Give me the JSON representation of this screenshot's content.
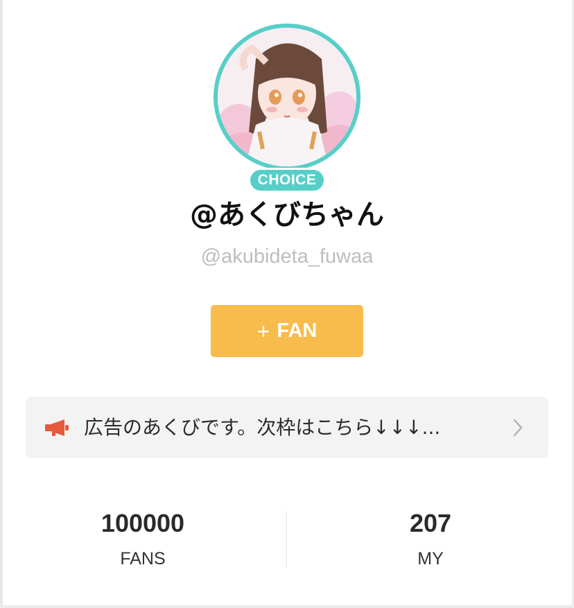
{
  "profile": {
    "badge": "CHOICE",
    "display_name": "@あくびちゃん",
    "user_id": "@akubideta_fuwaa",
    "avatar": "avatar-illustration"
  },
  "fan_button": {
    "icon": "plus-icon",
    "plus": "+",
    "label": "FAN"
  },
  "notice": {
    "icon": "megaphone-icon",
    "text": "広告のあくびです。次枠はこちら↓↓↓...",
    "chevron": "chevron-right-icon"
  },
  "stats": [
    {
      "value": "100000",
      "label": "FANS"
    },
    {
      "value": "207",
      "label": "MY"
    }
  ],
  "colors": {
    "accent_teal": "#57cfc8",
    "button_yellow": "#f7bc4c",
    "megaphone_orange": "#e55a3c",
    "notice_bg": "#f3f3f3"
  }
}
